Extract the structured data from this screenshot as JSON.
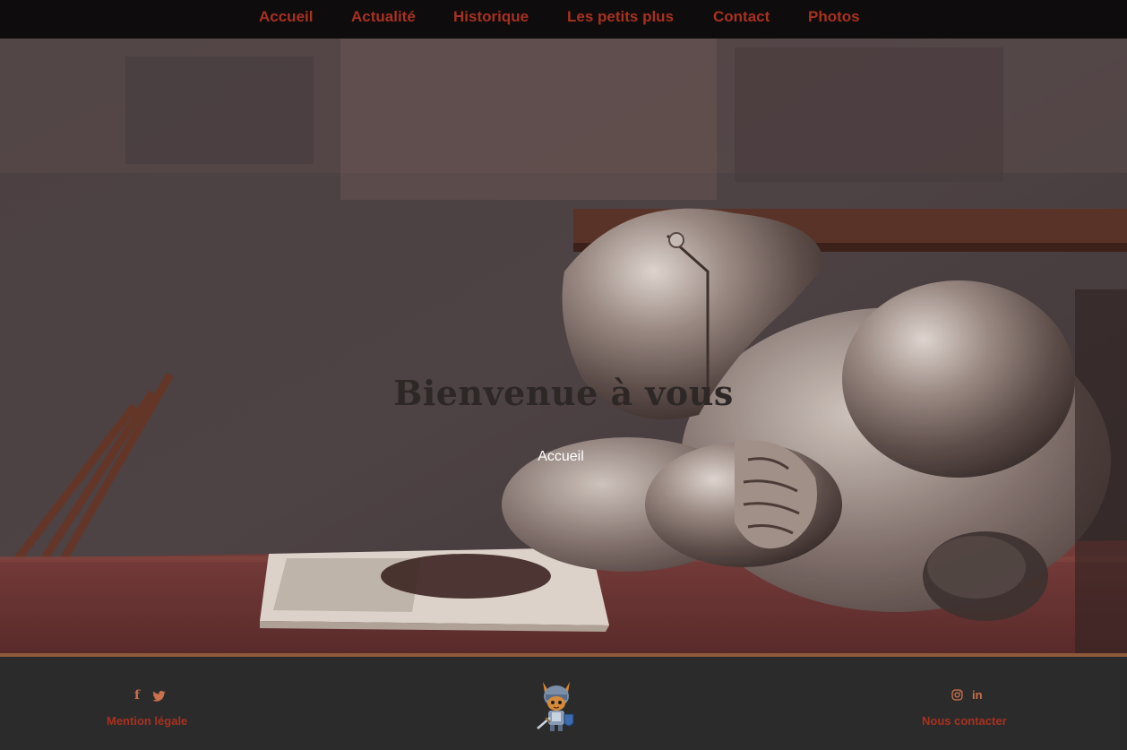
{
  "nav": {
    "items": [
      {
        "label": "Accueil"
      },
      {
        "label": "Actualité"
      },
      {
        "label": "Historique"
      },
      {
        "label": "Les petits plus"
      },
      {
        "label": "Contact"
      },
      {
        "label": "Photos"
      }
    ]
  },
  "hero": {
    "title": "Bienvenue à vous",
    "subtitle": "Accueil"
  },
  "footer": {
    "left_social": [
      "facebook-icon",
      "twitter-icon"
    ],
    "left_link": "Mention légale",
    "logo": "knight-mascot-logo",
    "right_social": [
      "instagram-icon",
      "linkedin-icon"
    ],
    "right_link": "Nous contacter"
  },
  "colors": {
    "nav_bg": "#0e0c0c",
    "link_red": "#a8311f",
    "footer_bg": "#2b2b2b",
    "divider": "#8e5a3a",
    "icon_orange": "#c9704c"
  }
}
